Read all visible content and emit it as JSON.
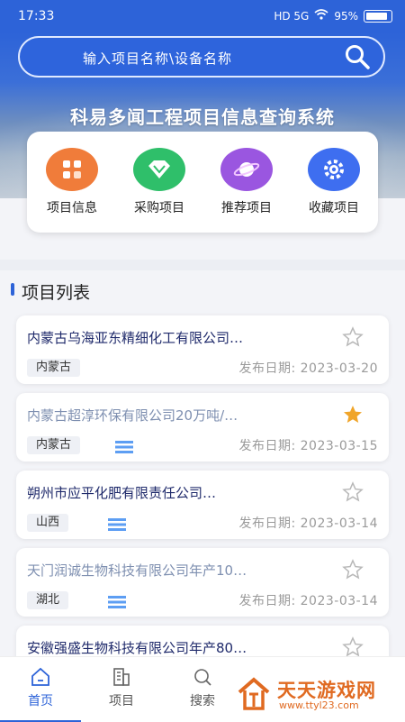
{
  "status": {
    "time": "17:33",
    "battery": "95%",
    "indicators": "HD 5G"
  },
  "search": {
    "placeholder": "输入项目名称\\设备名称"
  },
  "hero": {
    "title": "科易多闻工程项目信息查询系统"
  },
  "quick_links": [
    {
      "label": "项目信息",
      "icon": "grid-apps-icon",
      "color": "#f07c3a"
    },
    {
      "label": "采购项目",
      "icon": "diamond-icon",
      "color": "#2fbf6a"
    },
    {
      "label": "推荐项目",
      "icon": "planet-icon",
      "color": "#9a56e0"
    },
    {
      "label": "收藏项目",
      "icon": "gear-icon",
      "color": "#3e6ef0"
    }
  ],
  "section": {
    "title": "项目列表"
  },
  "projects": [
    {
      "title": "内蒙古乌海亚东精细化工有限公司…",
      "region": "内蒙古",
      "date": "发布日期: 2023-03-20",
      "starred": false,
      "has_doc": false,
      "dim": false
    },
    {
      "title": "内蒙古超淳环保有限公司20万吨/…",
      "region": "内蒙古",
      "date": "发布日期: 2023-03-15",
      "starred": true,
      "has_doc": true,
      "dim": true
    },
    {
      "title": "朔州市应平化肥有限责任公司…",
      "region": "山西",
      "date": "发布日期: 2023-03-14",
      "starred": false,
      "has_doc": true,
      "dim": false
    },
    {
      "title": "天门润诚生物科技有限公司年产10…",
      "region": "湖北",
      "date": "发布日期: 2023-03-14",
      "starred": false,
      "has_doc": true,
      "dim": true
    },
    {
      "title": "安徽强盛生物科技有限公司年产80…",
      "region": "",
      "date": "",
      "starred": false,
      "has_doc": false,
      "dim": false
    }
  ],
  "nav": [
    {
      "label": "首页",
      "icon": "home-icon",
      "active": true
    },
    {
      "label": "项目",
      "icon": "building-icon",
      "active": false
    },
    {
      "label": "搜索",
      "icon": "search-icon",
      "active": false
    }
  ],
  "watermark": {
    "name": "天天游戏网",
    "url": "www.ttyl23.com"
  },
  "colors": {
    "primary": "#2d63d8",
    "star_active": "#f0a52a",
    "title_dim": "#7e8fb0",
    "title": "#1f2a6b"
  }
}
